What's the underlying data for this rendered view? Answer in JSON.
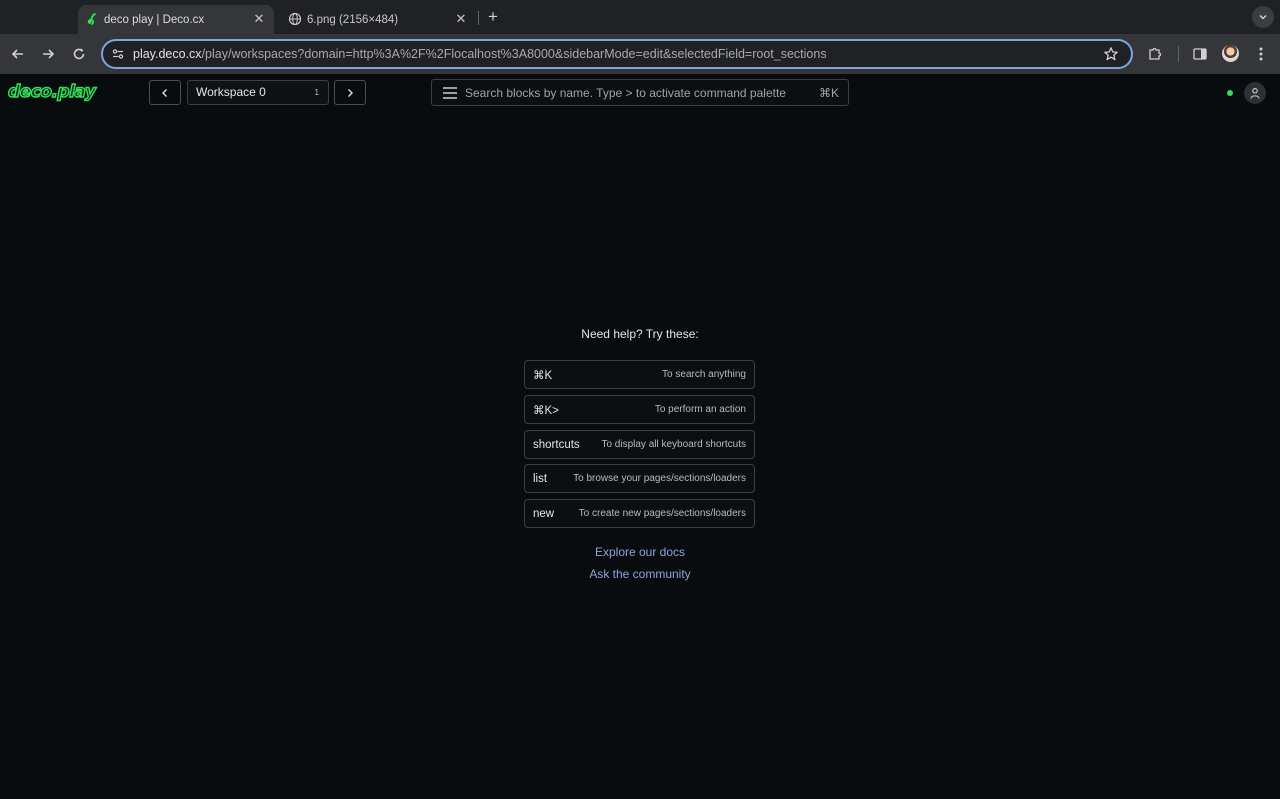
{
  "browser": {
    "tabs": [
      {
        "title": "deco play | Deco.cx",
        "active": true
      },
      {
        "title": "6.png (2156×484)",
        "active": false
      }
    ],
    "url_host": "play.deco.cx",
    "url_path": "/play/workspaces?domain=http%3A%2F%2Flocalhost%3A8000&sidebarMode=edit&selectedField=root_sections"
  },
  "header": {
    "logo": "deco.play",
    "workspace_name": "Workspace 0",
    "workspace_count": "1",
    "search_placeholder": "Search blocks by name. Type > to activate command palette",
    "search_shortcut": "⌘K",
    "status_color": "#2fdc5c"
  },
  "help": {
    "title": "Need help? Try these:",
    "items": [
      {
        "key": "⌘K",
        "desc": "To search anything"
      },
      {
        "key": "⌘K>",
        "desc": "To perform an action"
      },
      {
        "key": "shortcuts",
        "desc": "To display all keyboard shortcuts"
      },
      {
        "key": "list",
        "desc": "To browse your pages/sections/loaders"
      },
      {
        "key": "new",
        "desc": "To create new pages/sections/loaders"
      }
    ],
    "links": [
      {
        "label": "Explore our docs"
      },
      {
        "label": "Ask the community"
      }
    ]
  }
}
